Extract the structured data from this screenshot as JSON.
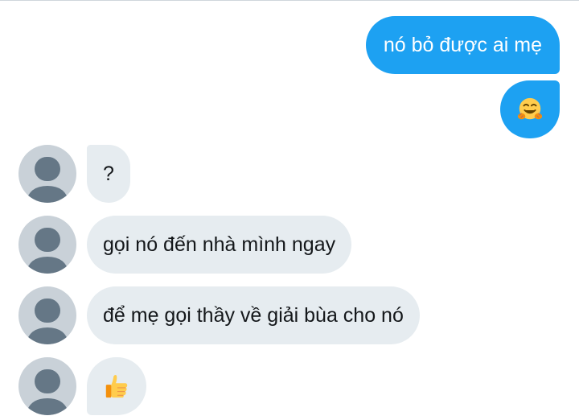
{
  "conversation": {
    "messages": [
      {
        "from": "me",
        "text": "nó bỏ được ai mẹ"
      },
      {
        "from": "me",
        "emoji": "hugging-face"
      },
      {
        "from": "them",
        "text": "?"
      },
      {
        "from": "them",
        "text": "gọi nó đến nhà mình ngay"
      },
      {
        "from": "them",
        "text": "để mẹ gọi thầy về giải bùa cho nó"
      },
      {
        "from": "them",
        "emoji": "thumbs-up"
      }
    ]
  },
  "colors": {
    "outgoing_bubble": "#1da1f2",
    "incoming_bubble": "#e6ecf0",
    "avatar_bg": "#c9d1d8",
    "avatar_figure": "#657786"
  }
}
